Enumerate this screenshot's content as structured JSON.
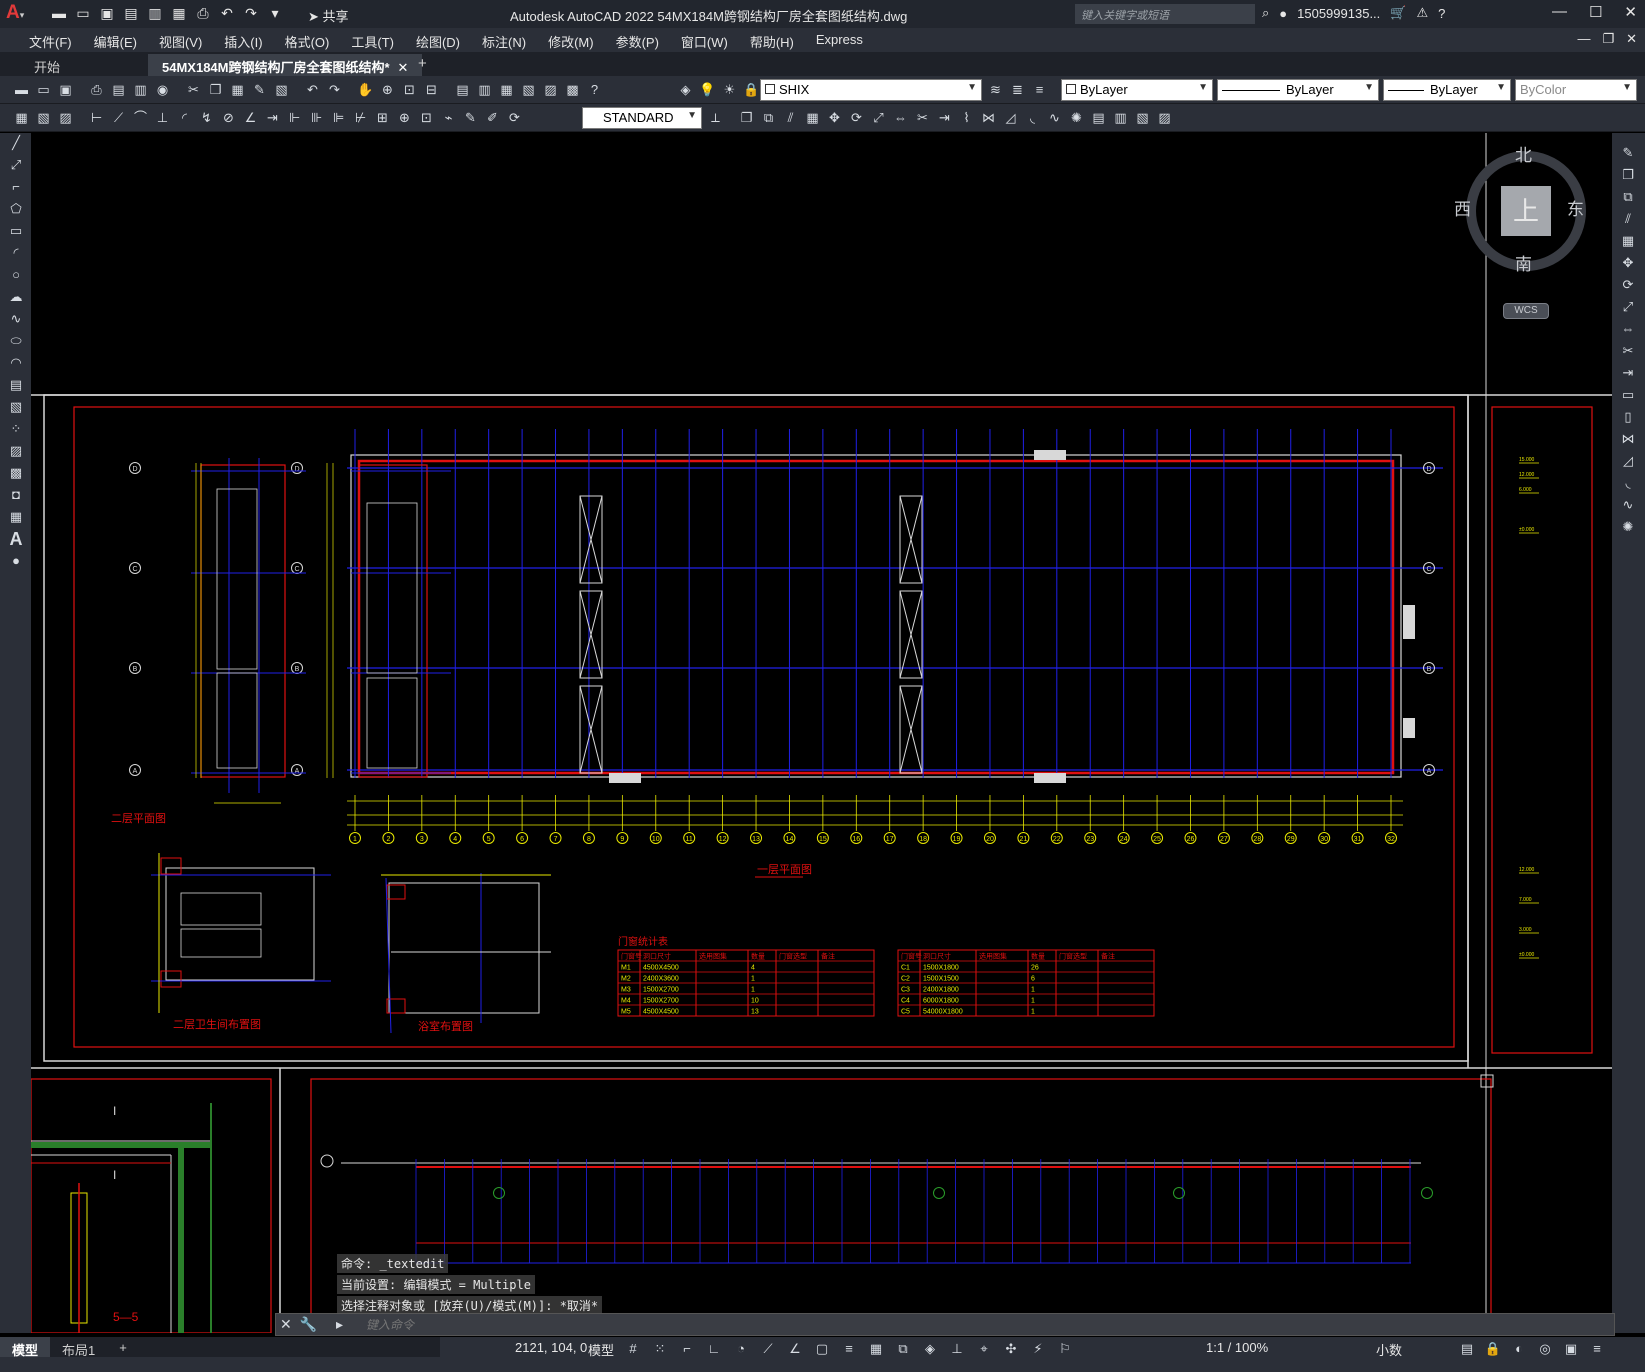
{
  "titlebar": {
    "app_logo": "A",
    "share_label": "共享",
    "title": "Autodesk AutoCAD 2022    54MX184M跨钢结构厂房全套图纸结构.dwg",
    "search_placeholder": "键入关键字或短语",
    "user": "1505999135...",
    "icons": [
      "new-icon",
      "open-icon",
      "save-icon",
      "save-as-icon",
      "open-from-web-icon",
      "save-to-web-icon",
      "plot-icon",
      "undo-icon",
      "redo-icon",
      "customize-icon",
      "share-icon"
    ]
  },
  "menubar": {
    "items": [
      "文件(F)",
      "编辑(E)",
      "视图(V)",
      "插入(I)",
      "格式(O)",
      "工具(T)",
      "绘图(D)",
      "标注(N)",
      "修改(M)",
      "参数(P)",
      "窗口(W)",
      "帮助(H)",
      "Express"
    ]
  },
  "tabs": {
    "start": "开始",
    "file": "54MX184M跨钢结构厂房全套图纸结构*"
  },
  "toolbar": {
    "layer": "SHIX",
    "color": "ByLayer",
    "linetype": "ByLayer",
    "lineweight": "ByLayer",
    "plotstyle": "ByColor",
    "textstyle": "STANDARD"
  },
  "viewcube": {
    "north": "北",
    "south": "南",
    "east": "东",
    "west": "西",
    "face": "上",
    "wcs": "WCS"
  },
  "drawing": {
    "title_floor1": "一层平面图",
    "title_floor2": "二层平面图",
    "title_toilet": "二层卫生间布置图",
    "title_shower": "浴室布置图",
    "title_section": "5—5",
    "door_table_title": "门窗统计表",
    "door_table": {
      "headers": [
        "门窗号",
        "洞口尺寸",
        "选用图集",
        "数量",
        "门窗选型",
        "备注"
      ],
      "rows": [
        [
          "M1",
          "4500X4500",
          "",
          "4",
          "",
          ""
        ],
        [
          "M2",
          "2400X3600",
          "",
          "1",
          "",
          ""
        ],
        [
          "M3",
          "1500X2700",
          "",
          "1",
          "",
          ""
        ],
        [
          "M4",
          "1500X2700",
          "",
          "10",
          "",
          ""
        ],
        [
          "M5",
          "4500X4500",
          "",
          "13",
          "",
          ""
        ]
      ]
    },
    "window_table": {
      "headers": [
        "门窗号",
        "洞口尺寸",
        "选用图集",
        "数量",
        "门窗选型",
        "备注"
      ],
      "rows": [
        [
          "C1",
          "1500X1800",
          "",
          "26",
          "",
          ""
        ],
        [
          "C2",
          "1500X1500",
          "",
          "6",
          "",
          ""
        ],
        [
          "C3",
          "2400X1800",
          "",
          "1",
          "",
          ""
        ],
        [
          "C4",
          "6000X1800",
          "",
          "1",
          "",
          ""
        ],
        [
          "C5",
          "54000X1800",
          "",
          "1",
          "",
          ""
        ]
      ]
    },
    "axis_numbers": [
      "1",
      "2",
      "3",
      "4",
      "5",
      "6",
      "7",
      "8",
      "9",
      "10",
      "11",
      "12",
      "13",
      "14",
      "15",
      "16",
      "17",
      "18",
      "19",
      "20",
      "21",
      "22",
      "23",
      "24",
      "25",
      "26",
      "27",
      "28",
      "29",
      "30",
      "31",
      "32"
    ],
    "axis_letters": [
      "D",
      "C",
      "B",
      "A"
    ]
  },
  "command": {
    "history": [
      "命令: _textedit",
      "当前设置: 编辑模式 = Multiple",
      "选择注释对象或 [放弃(U)/模式(M)]: *取消*"
    ],
    "placeholder": "键入命令"
  },
  "statusbar": {
    "tabs": [
      "模型",
      "布局1"
    ],
    "coords": "2121, 104, 0",
    "model": "模型",
    "scale": "1:1 / 100%",
    "units": "小数"
  }
}
